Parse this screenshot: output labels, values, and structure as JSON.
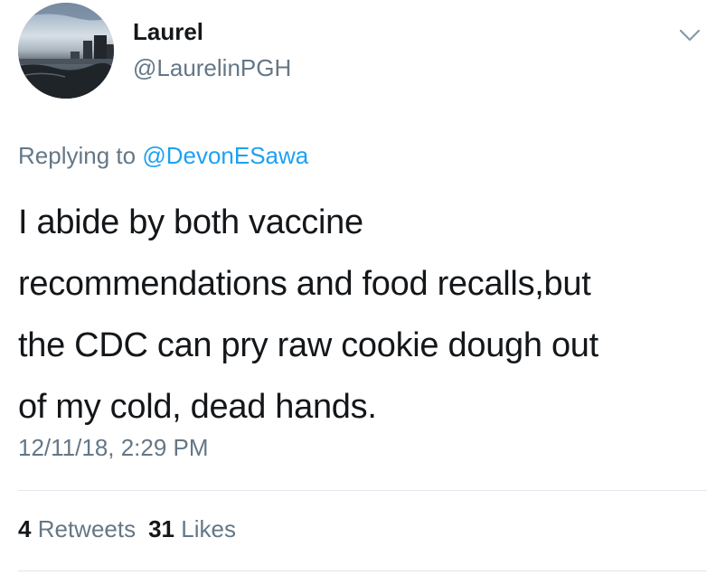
{
  "author": {
    "display_name": "Laurel",
    "handle": "@LaurelinPGH"
  },
  "reply": {
    "prefix": "Replying to",
    "to_handle": "@DevonESawa"
  },
  "tweet": {
    "lines": [
      "I abide by both vaccine",
      "recommendations and food recalls,but",
      "the CDC can pry raw cookie dough out",
      "of my cold, dead hands."
    ],
    "timestamp": "12/11/18, 2:29 PM"
  },
  "stats": {
    "retweets_count": "4",
    "retweets_label": "Retweets",
    "likes_count": "31",
    "likes_label": "Likes"
  },
  "icons": {
    "menu": "chevron-down-icon"
  },
  "colors": {
    "link": "#1da1f2",
    "secondary_text": "#657786",
    "primary_text": "#14171a",
    "divider": "#e1e8ed"
  }
}
